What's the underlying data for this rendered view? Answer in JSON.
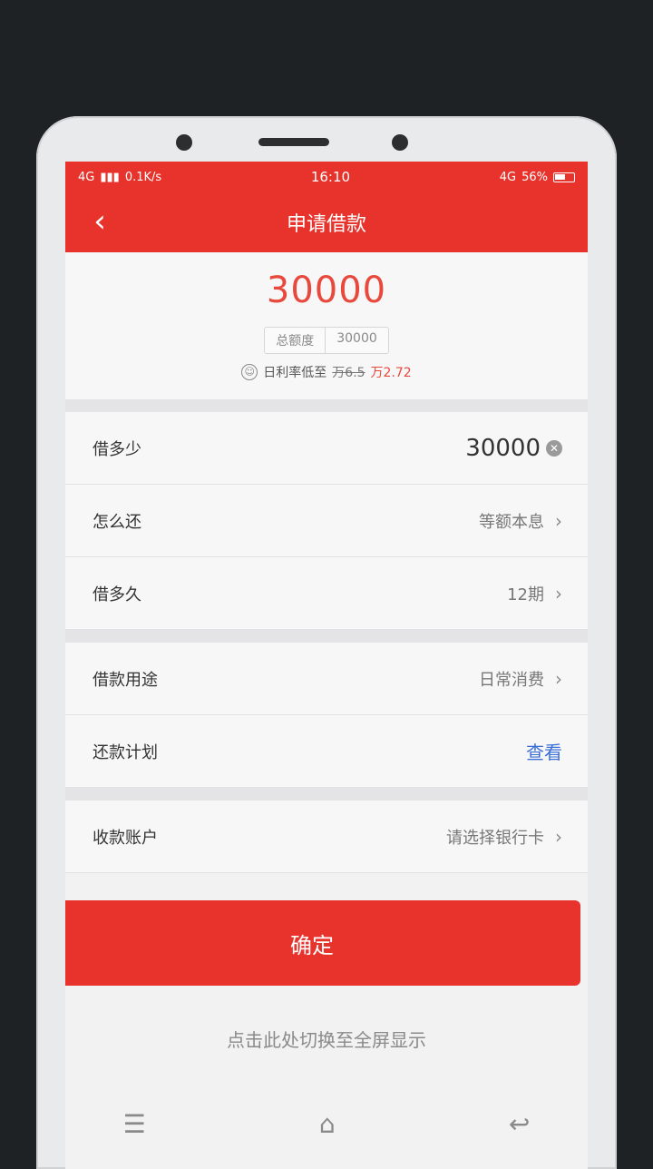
{
  "status_bar": {
    "network_left": "4G",
    "speed": "0.1K/s",
    "time": "16:10",
    "network_right": "4G",
    "battery": "56%"
  },
  "nav": {
    "back_icon": "chevron-left-icon",
    "title": "申请借款"
  },
  "header": {
    "amount": "30000",
    "total_label": "总额度",
    "total_value": "30000",
    "rate_prefix": "日利率低至",
    "rate_old": "万6.5",
    "rate_new": "万2.72"
  },
  "form": {
    "borrow_amount": {
      "label": "借多少",
      "value": "30000"
    },
    "repay_method": {
      "label": "怎么还",
      "value": "等额本息"
    },
    "term": {
      "label": "借多久",
      "value": "12期"
    },
    "purpose": {
      "label": "借款用途",
      "value": "日常消费"
    },
    "plan": {
      "label": "还款计划",
      "value": "查看"
    },
    "account": {
      "label": "收款账户",
      "value": "请选择银行卡"
    }
  },
  "confirm_label": "确定",
  "fullscreen_hint": "点击此处切换至全屏显示",
  "colors": {
    "brand_red": "#e8332c",
    "amount_red": "#e8493c",
    "link_blue": "#3a6fd8"
  }
}
